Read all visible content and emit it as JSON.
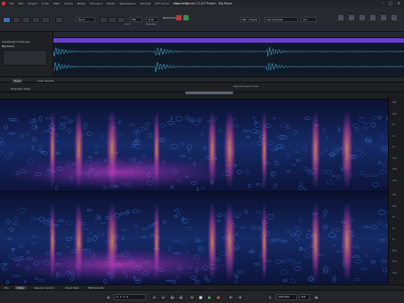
{
  "window": {
    "title": "Cubase Version 12.0.0 Project - Big Room"
  },
  "menu": [
    "File",
    "Edit",
    "Project",
    "Audio",
    "MIDI",
    "Scores",
    "Media",
    "Transport",
    "Studio",
    "Workspaces",
    "Window",
    "VST Cloud",
    "Hub",
    "Help"
  ],
  "toolbar": {
    "fields": [
      {
        "label": "",
        "value": "Touch"
      },
      {
        "label": "Grid",
        "value": "Bar"
      },
      {
        "label": "Quantize",
        "value": "1/16"
      },
      {
        "label": "",
        "value": "Bar + Beats"
      },
      {
        "label": "",
        "value": "Use Quantize"
      },
      {
        "label": "",
        "value": "1/4"
      }
    ],
    "clip_name": "Bassloop-Euro"
  },
  "inspector": {
    "section": "Input/Output Channels",
    "track_name": "Big Room"
  },
  "lower_zone": {
    "tabs": [
      "Track",
      "Audio Events"
    ],
    "spectrum_title": "Spectral Layers One",
    "time_info": "Time fade: 0.00 s"
  },
  "freq_ticks": [
    "20k",
    "10k",
    "5k",
    "2k",
    "1k",
    "500",
    "200",
    "100",
    "20k",
    "10k",
    "5k",
    "2k",
    "1k",
    "500",
    "200",
    "100"
  ],
  "bottom_tabs": [
    "Mix",
    "Editor",
    "Sampler Control",
    "Chord Pads",
    "MIDI Remote"
  ],
  "transport": {
    "position": "1. 1. 1. 0",
    "tempo": "120.000",
    "signature": "4/4"
  },
  "colors": {
    "clip": "#6a3fd0",
    "waveform": "#4fb8e8",
    "accent": "#3b6fb5"
  }
}
